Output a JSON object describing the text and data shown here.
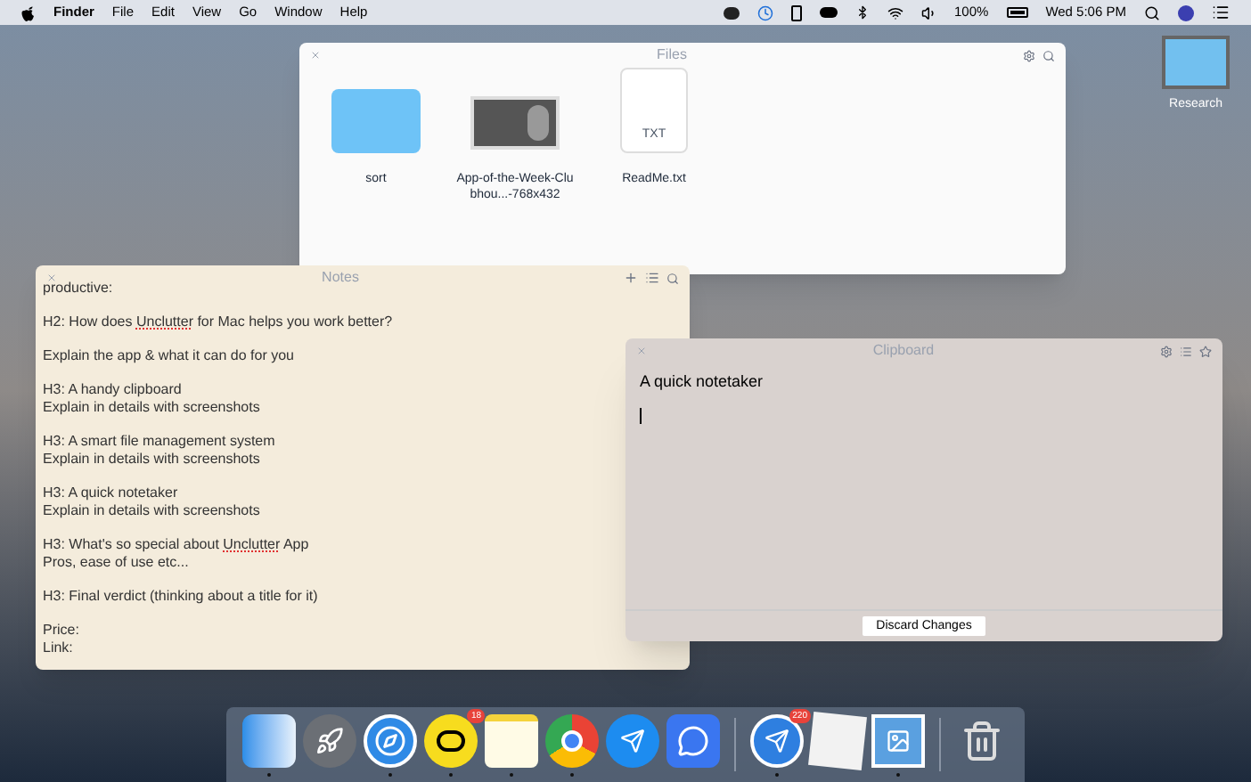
{
  "menubar": {
    "menus": [
      {
        "label": "Finder",
        "kind": "app"
      },
      {
        "label": "File",
        "kind": "menu"
      },
      {
        "label": "Edit",
        "kind": "menu"
      },
      {
        "label": "View",
        "kind": "menu"
      },
      {
        "label": "Go",
        "kind": "menu"
      },
      {
        "label": "Window",
        "kind": "menu"
      },
      {
        "label": "Help",
        "kind": "menu"
      }
    ],
    "battery": "100%",
    "clock": "Wed 5:06 PM"
  },
  "desktop_icons": [
    {
      "label": "Research"
    }
  ],
  "files_window": {
    "title": "Files",
    "items": [
      {
        "kind": "folder",
        "label": "sort"
      },
      {
        "kind": "image",
        "label": "App-of-the-Week-Clubhou...-768x432"
      },
      {
        "kind": "text",
        "label": "ReadMe.txt",
        "tag": "TXT"
      }
    ]
  },
  "notes_window": {
    "title": "Notes",
    "paragraphs": [
      {
        "lines": [
          [
            {
              "text": "productive:",
              "misspelled": false
            }
          ]
        ]
      },
      {
        "lines": [
          [
            {
              "text": "H2: How does ",
              "misspelled": false
            },
            {
              "text": "Unclutter",
              "misspelled": true
            },
            {
              "text": " for Mac helps you work better?",
              "misspelled": false
            }
          ]
        ]
      },
      {
        "lines": [
          [
            {
              "text": "Explain the app & what it can do for you",
              "misspelled": false
            }
          ]
        ]
      },
      {
        "lines": [
          [
            {
              "text": "H3: A handy clipboard",
              "misspelled": false
            }
          ],
          [
            {
              "text": "Explain in details with screenshots",
              "misspelled": false
            }
          ]
        ]
      },
      {
        "lines": [
          [
            {
              "text": "H3: A smart file management system",
              "misspelled": false
            }
          ],
          [
            {
              "text": "Explain in details with screenshots",
              "misspelled": false
            }
          ]
        ]
      },
      {
        "lines": [
          [
            {
              "text": "H3: A quick notetaker",
              "misspelled": false
            }
          ],
          [
            {
              "text": "Explain in details with screenshots",
              "misspelled": false
            }
          ]
        ]
      },
      {
        "lines": [
          [
            {
              "text": "H3: What's so special about ",
              "misspelled": false
            },
            {
              "text": "Unclutter",
              "misspelled": true
            },
            {
              "text": " App",
              "misspelled": false
            }
          ],
          [
            {
              "text": "Pros, ease of use etc...",
              "misspelled": false
            }
          ]
        ]
      },
      {
        "lines": [
          [
            {
              "text": "H3: Final verdict (thinking about a title for it)",
              "misspelled": false
            }
          ]
        ]
      },
      {
        "lines": [
          [
            {
              "text": "Price:",
              "misspelled": false
            }
          ],
          [
            {
              "text": "Link:",
              "misspelled": false
            }
          ]
        ]
      }
    ]
  },
  "clipboard_window": {
    "title": "Clipboard",
    "content": "A quick notetaker",
    "button": "Discard Changes"
  },
  "dock": {
    "items": [
      {
        "kind": "finder",
        "running": true
      },
      {
        "kind": "rocket",
        "running": false
      },
      {
        "kind": "compass",
        "running": true
      },
      {
        "kind": "yellow",
        "running": true,
        "badge": "18"
      },
      {
        "kind": "notepad",
        "running": true
      },
      {
        "kind": "chrome",
        "running": true
      },
      {
        "kind": "store",
        "running": false
      },
      {
        "kind": "chat",
        "running": false
      },
      {
        "kind": "separator"
      },
      {
        "kind": "plane",
        "running": true,
        "badge": "220"
      },
      {
        "kind": "paper",
        "running": false
      },
      {
        "kind": "preview",
        "running": true
      },
      {
        "kind": "separator"
      },
      {
        "kind": "trash",
        "running": false
      }
    ]
  }
}
